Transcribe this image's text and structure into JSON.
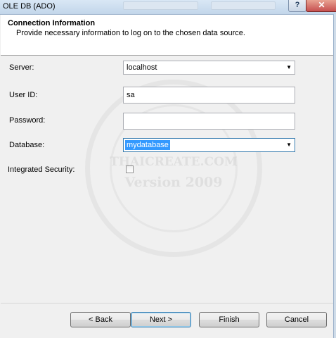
{
  "window": {
    "title": "OLE DB (ADO)",
    "help_glyph": "?",
    "close_glyph": "✕"
  },
  "header": {
    "title": "Connection Information",
    "description": "Provide necessary information to log on to the chosen data source."
  },
  "form": {
    "server": {
      "label": "Server:",
      "value": "localhost"
    },
    "user_id": {
      "label": "User ID:",
      "value": "sa"
    },
    "password": {
      "label": "Password:",
      "value": ""
    },
    "database": {
      "label": "Database:",
      "value": "mydatabase"
    },
    "integrated_security": {
      "label": "Integrated Security:",
      "checked": false
    }
  },
  "watermark": {
    "line1": "THAICREATE.COM",
    "line2": "Version 2009"
  },
  "buttons": {
    "back": "< Back",
    "next": "Next >",
    "finish": "Finish",
    "cancel": "Cancel"
  },
  "colors": {
    "selection": "#3399ff",
    "close_button": "#c75050",
    "header_bg": "#ffffff",
    "body_bg": "#f0f0f0"
  }
}
